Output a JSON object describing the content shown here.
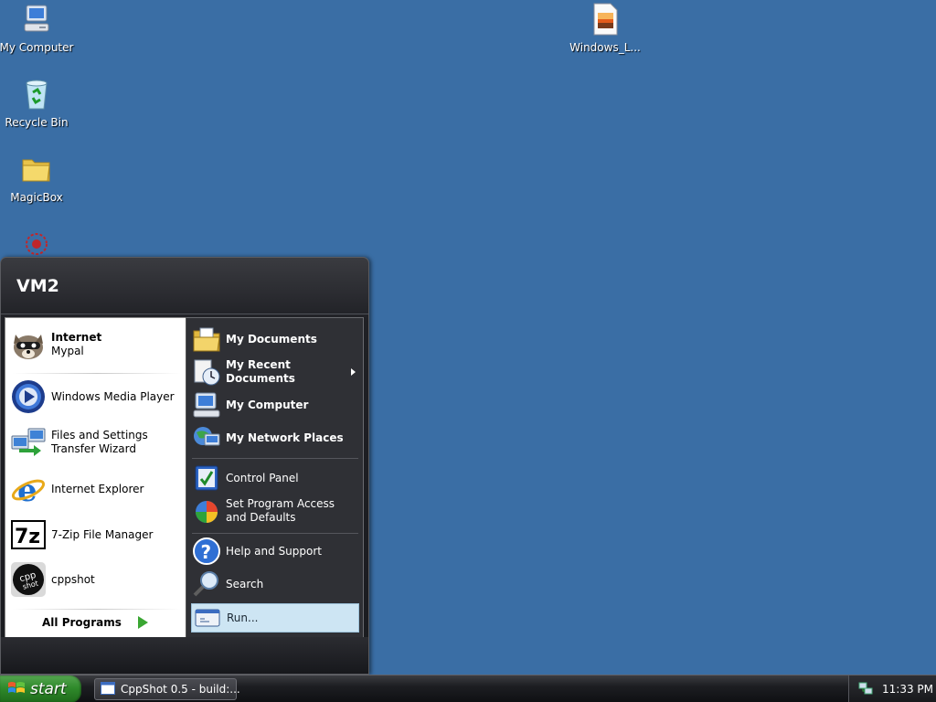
{
  "desktop": {
    "icons": [
      {
        "label": "My Computer",
        "icon": "my-computer-icon"
      },
      {
        "label": "Recycle Bin",
        "icon": "recycle-bin-icon"
      },
      {
        "label": "MagicBox",
        "icon": "folder-icon"
      },
      {
        "label": "Windows_L...",
        "icon": "image-file-icon"
      }
    ]
  },
  "start_menu": {
    "user_name": "VM2",
    "left_items": [
      {
        "title": "Internet",
        "subtitle": "Mypal",
        "icon": "mypal-icon"
      },
      {
        "title": "Windows Media Player",
        "icon": "media-player-icon"
      },
      {
        "title": "Files and Settings Transfer Wizard",
        "icon": "transfer-wizard-icon"
      },
      {
        "title": "Internet Explorer",
        "icon": "internet-explorer-icon"
      },
      {
        "title": "7-Zip File Manager",
        "icon": "7zip-icon"
      },
      {
        "title": "cppshot",
        "icon": "cppshot-icon"
      }
    ],
    "all_programs_label": "All Programs",
    "right_items": [
      {
        "label": "My Documents",
        "icon": "my-documents-icon"
      },
      {
        "label": "My Recent Documents",
        "icon": "recent-documents-icon",
        "has_submenu": true
      },
      {
        "label": "My Computer",
        "icon": "my-computer-icon"
      },
      {
        "label": "My Network Places",
        "icon": "network-places-icon"
      },
      {
        "label": "Control Panel",
        "icon": "control-panel-icon"
      },
      {
        "label": "Set Program Access and Defaults",
        "icon": "program-access-icon"
      },
      {
        "label": "Help and Support",
        "icon": "help-icon"
      },
      {
        "label": "Search",
        "icon": "search-icon"
      },
      {
        "label": "Run...",
        "icon": "run-icon",
        "highlighted": true
      }
    ]
  },
  "taskbar": {
    "start_label": "start",
    "tasks": [
      {
        "label": "CppShot 0.5 - build:...",
        "icon": "window-icon"
      }
    ],
    "clock": "11:33 PM"
  }
}
